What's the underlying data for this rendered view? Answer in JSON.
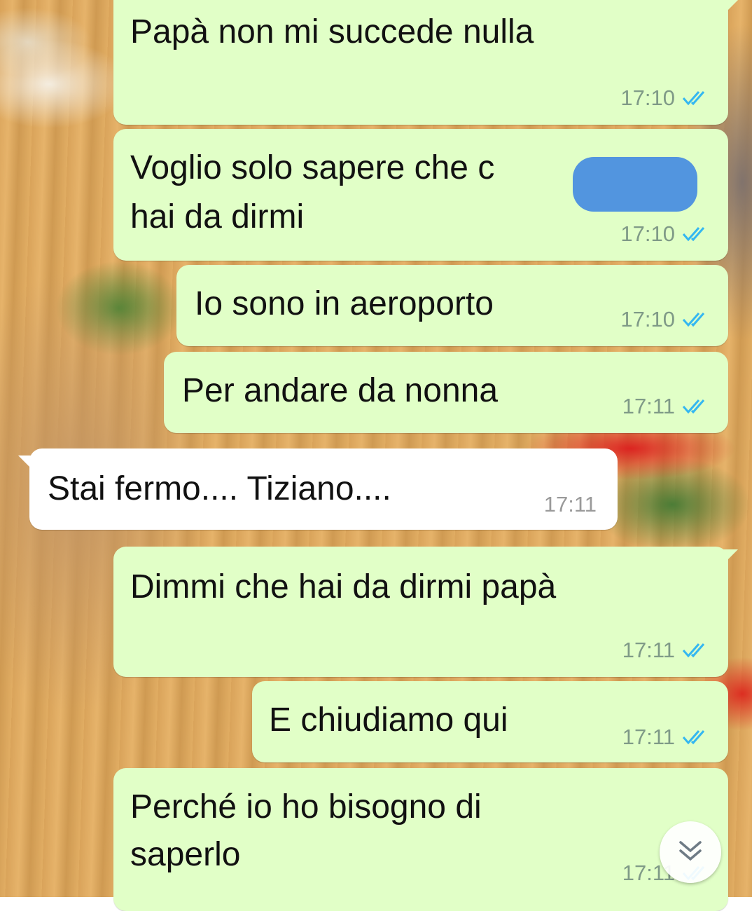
{
  "colors": {
    "outgoing_bubble": "#e1ffc7",
    "incoming_bubble": "#ffffff",
    "read_ticks": "#34b7f1",
    "redaction": "#4a8fe0"
  },
  "messages": [
    {
      "direction": "outgoing",
      "text": "Papà non mi succede nulla",
      "time": "17:10",
      "status": "read"
    },
    {
      "direction": "outgoing",
      "line1": "Voglio solo sapere che c",
      "line2": "hai da dirmi",
      "time": "17:10",
      "status": "read",
      "redacted": true
    },
    {
      "direction": "outgoing",
      "text": "Io sono in aeroporto",
      "time": "17:10",
      "status": "read"
    },
    {
      "direction": "outgoing",
      "text": "Per andare da nonna",
      "time": "17:11",
      "status": "read"
    },
    {
      "direction": "incoming",
      "text": "Stai fermo.... Tiziano....",
      "time": "17:11"
    },
    {
      "direction": "outgoing",
      "text": "Dimmi che hai da dirmi papà",
      "time": "17:11",
      "status": "read"
    },
    {
      "direction": "outgoing",
      "text": "E chiudiamo qui",
      "time": "17:11",
      "status": "read"
    },
    {
      "direction": "outgoing",
      "line1": "Perché io ho bisogno di",
      "line2": "saperlo",
      "time": "17:11",
      "status": "read"
    }
  ],
  "scroll_button": {
    "icon": "double-chevron-down-icon"
  }
}
